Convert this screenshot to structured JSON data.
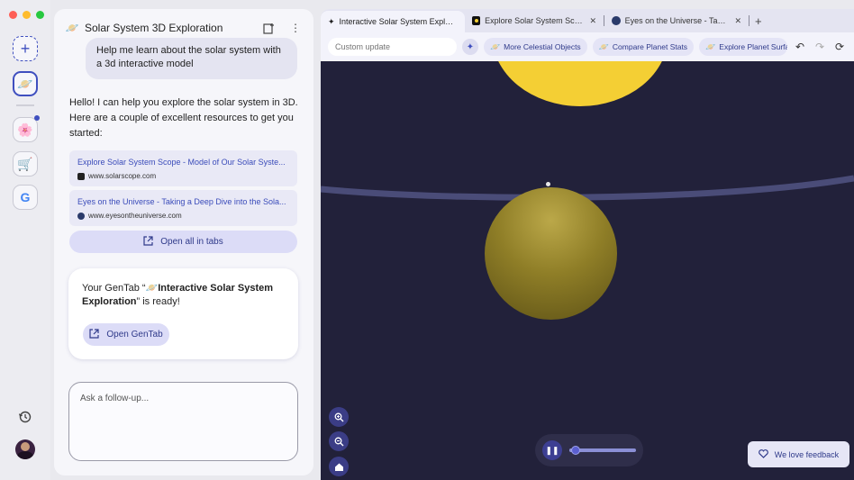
{
  "colors": {
    "accent": "#3f4fbf",
    "traffic_red": "#fe5f57",
    "traffic_yellow": "#febc2e",
    "traffic_green": "#28c840",
    "space": "#22213a",
    "sun": "#f4cf34",
    "planet": "#8f7e27",
    "orbit": "#4a4c78"
  },
  "rail": {
    "new_icon": "plus-icon",
    "items": [
      {
        "name": "gentab-solar",
        "icon": "🪐"
      },
      {
        "name": "group-flower",
        "icon": "🌸"
      },
      {
        "name": "group-cart",
        "icon": "🛒"
      },
      {
        "name": "google",
        "icon": "G"
      }
    ],
    "history_icon": "history-icon",
    "avatar_icon": "user-avatar"
  },
  "chat": {
    "title_icon": "🪐",
    "title": "Solar System 3D Exploration",
    "user_message": "Help me learn about the solar system with a 3d interactive model",
    "reply": "Hello! I can help you explore the solar system in 3D. Here are a couple of excellent resources to get you started:",
    "links": [
      {
        "title": "Explore Solar System Scope - Model of Our Solar Syste...",
        "domain": "www.solarscope.com",
        "favicon_color": "#222222"
      },
      {
        "title": "Eyes on the Universe - Taking a Deep Dive into the Sola...",
        "domain": "www.eyesontheuniverse.com",
        "favicon_color": "#2a3a6a"
      }
    ],
    "open_all_label": "Open all in tabs",
    "gentab_prefix": "Your GenTab “",
    "gentab_name": "🪐Interactive Solar System Exploration",
    "gentab_suffix": "” is ready!",
    "open_gentab_label": "Open GenTab",
    "followup_placeholder": "Ask a follow-up..."
  },
  "browser": {
    "tabs": [
      {
        "icon": "✦",
        "title": "Interactive Solar System Explor...",
        "active": true
      },
      {
        "icon": "■",
        "title": "Explore Solar System Scope -",
        "active": false
      },
      {
        "icon": "●",
        "title": "Eyes on the Universe - Taking",
        "active": false
      }
    ],
    "custom_update_placeholder": "Custom update",
    "chips": [
      {
        "icon": "🪐",
        "label": "More Celestial Objects"
      },
      {
        "icon": "🪐",
        "label": "Compare Planet Stats"
      },
      {
        "icon": "🪐",
        "label": "Explore Planet Surfa"
      }
    ],
    "player": {
      "progress": 0.1
    },
    "feedback_label": "We love feedback"
  }
}
